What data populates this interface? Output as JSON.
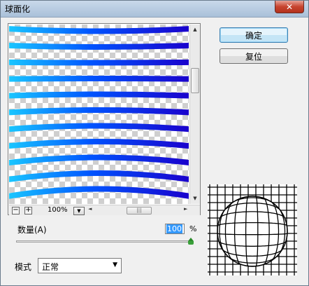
{
  "window": {
    "title": "球面化",
    "close_glyph": "✕"
  },
  "buttons": {
    "ok": "确定",
    "reset": "复位"
  },
  "preview": {
    "zoom": "100%",
    "zoom_out_glyph": "−",
    "zoom_in_glyph": "+",
    "dropdown_glyph": "▼",
    "scroll_up": "▲",
    "scroll_down": "▼",
    "scroll_left": "◄",
    "scroll_right": "►",
    "hthumb_grip": "|||",
    "stripe_colors": [
      "#1ac8ff",
      "#0055ff",
      "#1a00cc"
    ]
  },
  "amount": {
    "label": "数量(A)",
    "value": "100",
    "unit": "%",
    "slider_level": 1.0
  },
  "mode": {
    "label": "模式",
    "value": "正常",
    "caret": "▼"
  }
}
